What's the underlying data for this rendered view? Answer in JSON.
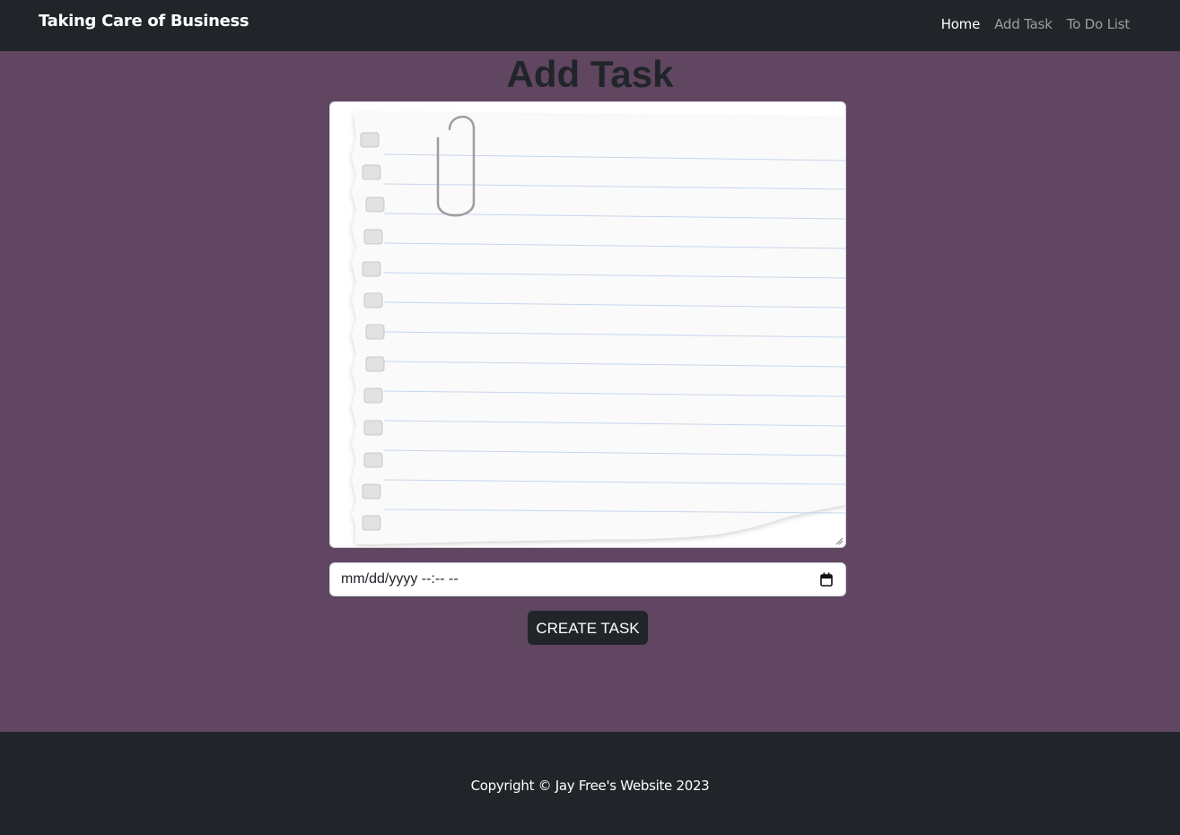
{
  "navbar": {
    "brand": "Taking Care of Business",
    "links": [
      {
        "label": "Home",
        "active": true
      },
      {
        "label": "Add Task",
        "active": false
      },
      {
        "label": "To Do List",
        "active": false
      }
    ]
  },
  "main": {
    "title": "Add Task",
    "textarea": {
      "value": "",
      "background": "lined notebook paper with paperclip"
    },
    "date_input": {
      "placeholder": "mm/dd/yyyy --:-- --"
    },
    "create_button": "CREATE TASK"
  },
  "footer": {
    "copyright": "Copyright © Jay Free's Website 2023"
  },
  "colors": {
    "page_background": "#604660",
    "navbar_background": "#212529",
    "accent": "#212529"
  },
  "icons": {
    "calendar": "calendar-icon",
    "resize": "resize-grip-icon",
    "paperclip": "paperclip-icon"
  }
}
